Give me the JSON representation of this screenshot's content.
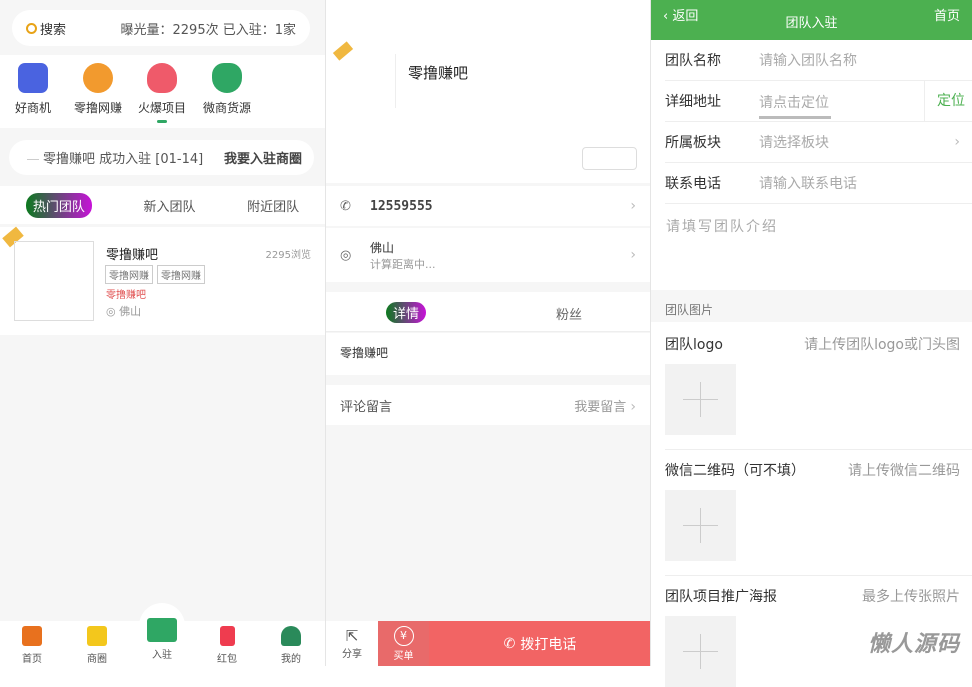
{
  "home": {
    "search_label": "搜索",
    "stats": "曝光量：2295次 已入驻：1家",
    "categories": [
      {
        "label": "好商机",
        "color": "#4a63e0"
      },
      {
        "label": "零撸网赚",
        "color": "#f29a2e"
      },
      {
        "label": "火爆项目",
        "color": "#ef5a6a"
      },
      {
        "label": "微商货源",
        "color": "#2fa764"
      }
    ],
    "notice": "零撸赚吧 成功入驻 [01-14]",
    "join_link": "我要入驻商圈",
    "tabs": [
      "热门团队",
      "新入团队",
      "附近团队"
    ],
    "card": {
      "name": "零撸赚吧",
      "views": "2295浏览",
      "tags": [
        "零撸网赚",
        "零撸网赚"
      ],
      "subtitle": "零撸赚吧",
      "location": "佛山"
    },
    "nav": [
      {
        "label": "首页"
      },
      {
        "label": "商圈"
      },
      {
        "label": "入驻"
      },
      {
        "label": "红包"
      },
      {
        "label": "我的"
      }
    ]
  },
  "detail": {
    "name": "零撸赚吧",
    "phone": "12559555",
    "city": "佛山",
    "distance": "计算距离中...",
    "tabs": [
      "详情",
      "粉丝"
    ],
    "description": "零撸赚吧",
    "comments_label": "评论留言",
    "comment_action": "我要留言",
    "share": "分享",
    "pay": "买单",
    "pay_symbol": "¥",
    "call": "拨打电话"
  },
  "form": {
    "back": "返回",
    "title": "团队入驻",
    "home": "首页",
    "fields": [
      {
        "label": "团队名称",
        "placeholder": "请输入团队名称"
      },
      {
        "label": "详细地址",
        "placeholder": "请点击定位"
      },
      {
        "label": "所属板块",
        "placeholder": "请选择板块"
      },
      {
        "label": "联系电话",
        "placeholder": "请输入联系电话"
      }
    ],
    "locate": "定位",
    "intro_placeholder": "请填写团队介绍",
    "section": "团队图片",
    "uploads": [
      {
        "label": "团队logo",
        "hint": "请上传团队logo或门头图"
      },
      {
        "label": "微信二维码（可不填）",
        "hint": "请上传微信二维码"
      },
      {
        "label": "团队项目推广海报",
        "hint": "最多上传张照片"
      }
    ],
    "watermark": "懒人源码"
  },
  "colors": {
    "green": "#4cb050",
    "red": "#f26464"
  }
}
